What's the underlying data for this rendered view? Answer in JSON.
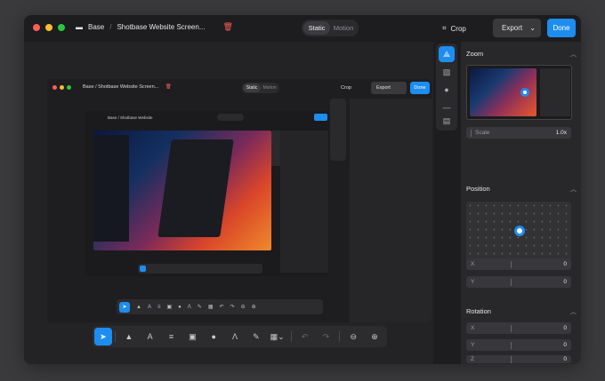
{
  "titlebar": {
    "crumb_root": "Base",
    "crumb_doc": "Shotbase Website Screen...",
    "mode_static": "Static",
    "mode_motion": "Motion",
    "crop_label": "Crop",
    "export_label": "Export",
    "done_label": "Done"
  },
  "nested": {
    "crumb_root": "Base",
    "crumb_doc": "Shotbase Website Screen...",
    "inner_crumb": "Base / Shotbase Website",
    "mode_static": "Static",
    "mode_motion": "Motion",
    "crop_label": "Crop",
    "export_label": "Export",
    "done_label": "Done"
  },
  "inspector": {
    "zoom": {
      "title": "Zoom",
      "scale_label": "Scale",
      "scale_value": "1.0x"
    },
    "position": {
      "title": "Position",
      "x_label": "X",
      "x_value": "0",
      "y_label": "Y",
      "y_value": "0"
    },
    "rotation": {
      "title": "Rotation",
      "x_label": "X",
      "x_value": "0",
      "y_label": "Y",
      "y_value": "0",
      "z_label": "Z",
      "z_value": "0"
    }
  },
  "colors": {
    "accent": "#1d8df0",
    "window_bg": "#1d1d1f",
    "panel_bg": "#28282b",
    "desktop_bg": "#3a3a3d"
  }
}
